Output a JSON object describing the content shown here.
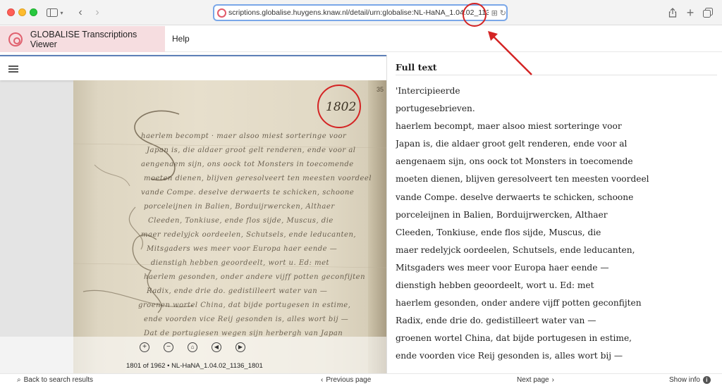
{
  "browser": {
    "url_prefix": "scriptions.globalise.huygens.knaw.nl/detail/urn:globalise:NL-HaNA_1.04.02_1136_",
    "url_highlight": "1801",
    "icons": {
      "sidebar": "sidebar-icon",
      "back": "chevron-left-icon",
      "forward": "chevron-right-icon",
      "share": "share-icon",
      "new_tab": "plus-icon",
      "tabs": "tabs-icon",
      "reload": "reload-icon"
    }
  },
  "app": {
    "brand_name": "GLOBALISE Transcriptions Viewer",
    "help_label": "Help",
    "accent_color": "#e0606e"
  },
  "viewer": {
    "folio_mark": "1802",
    "page_caption": "1801 of 1962 • NL-HaNA_1.04.02_1136_1801",
    "controls": [
      "zoom-in",
      "zoom-out",
      "reset",
      "previous",
      "next"
    ]
  },
  "fulltext": {
    "title": "Full text",
    "lines": [
      "'Intercipieerde",
      "portugesebrieven.",
      "haerlem becompt, maer alsoo miest sorteringe voor",
      "Japan is, die aldaer groot gelt renderen, ende voor al",
      "aengenaem sijn, ons oock tot Monsters in toecomende",
      "moeten dienen, blijven geresolveert ten meesten voordeel",
      "vande Compe. deselve derwaerts te schicken, schoone",
      "porceleijnen in Balien, Borduijrwercken, Althaer",
      "Cleeden, Tonkiuse, ende flos sijde, Muscus, die",
      "maer redelyjck oordeelen, Schutsels, ende leducanten,",
      "Mitsgaders wes meer voor Europa haer eende —",
      "dienstigh hebben geoordeelt, wort u. Ed: met",
      "haerlem gesonden, onder andere vijff potten geconfijten",
      "Radix, ende drie do. gedistilleert water van —",
      "groenen wortel China, dat bijde portugesen in estime,",
      "ende voorden vice Reij gesonden is, alles wort bij —"
    ]
  },
  "footer": {
    "back_label": "Back to search results",
    "prev_label": "Previous page",
    "next_label": "Next page",
    "info_label": "Show info"
  }
}
